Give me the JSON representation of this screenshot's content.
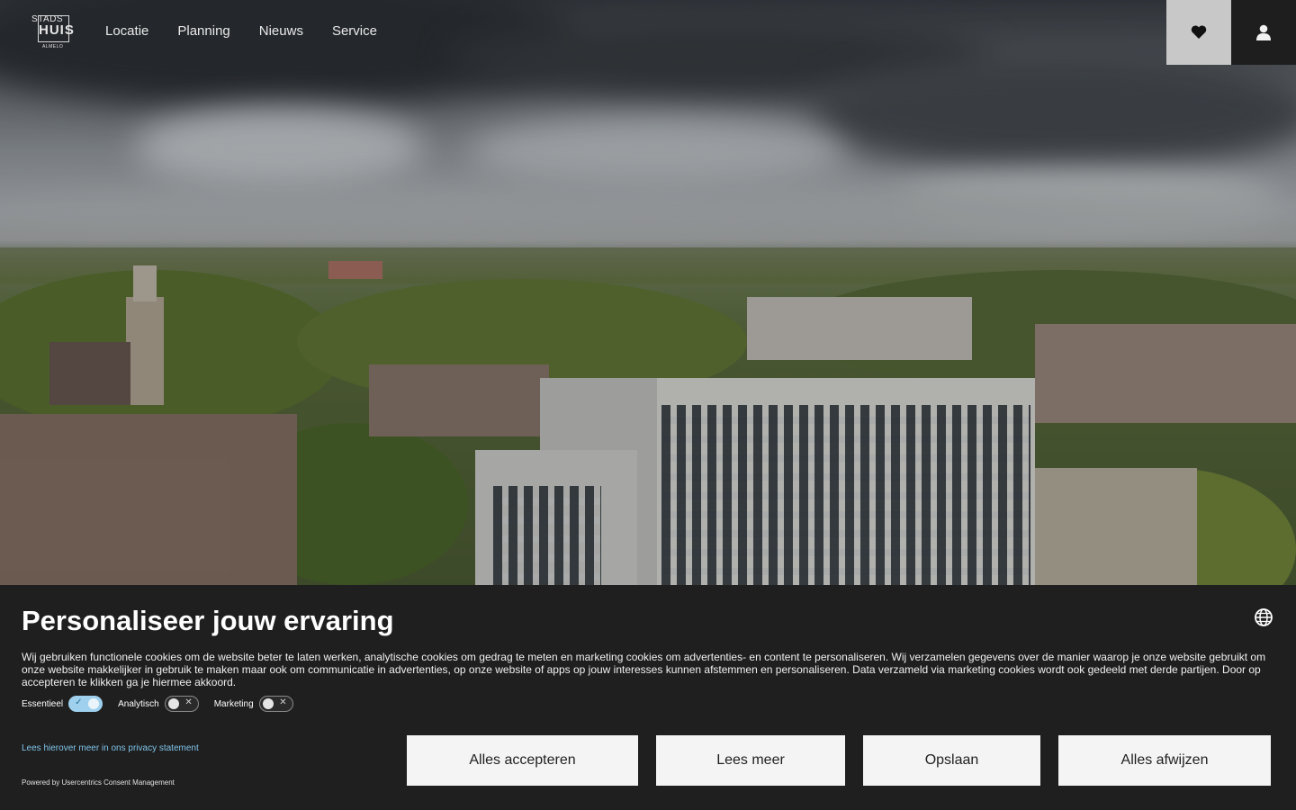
{
  "header": {
    "logo_text_top": "STADS",
    "logo_text_main": "HUIS",
    "logo_text_bottom": "ALMELO",
    "nav": [
      "Locatie",
      "Planning",
      "Nieuws",
      "Service"
    ],
    "favorites_icon": "heart-icon",
    "account_icon": "user-icon"
  },
  "consent": {
    "title": "Personaliseer jouw ervaring",
    "language_icon": "globe-icon",
    "description": "Wij gebruiken functionele cookies om de website beter te laten werken, analytische cookies om gedrag te meten en marketing cookies om advertenties- en content te personaliseren. Wij verzamelen gegevens over de manier waarop je onze website gebruikt om onze website makkelijker in gebruik te maken maar ook om communicatie in advertenties, op onze website of apps op jouw interesses kunnen afstemmen en personaliseren. Data verzameld via marketing cookies wordt ook gedeeld met derde partijen. Door op accepteren te klikken ga je hiermee akkoord.",
    "toggles": [
      {
        "label": "Essentieel",
        "enabled": true
      },
      {
        "label": "Analytisch",
        "enabled": false
      },
      {
        "label": "Marketing",
        "enabled": false
      }
    ],
    "privacy_link": "Lees hierover meer in ons privacy statement",
    "powered_by": "Powered by Usercentrics Consent Management",
    "buttons": {
      "accept_all": "Alles accepteren",
      "read_more": "Lees meer",
      "save": "Opslaan",
      "reject_all": "Alles afwijzen"
    }
  },
  "colors": {
    "banner_bg": "#1f1f1f",
    "button_bg": "#f4f4f4",
    "toggle_on": "#9fd1ee",
    "link": "#7fc4ea"
  }
}
